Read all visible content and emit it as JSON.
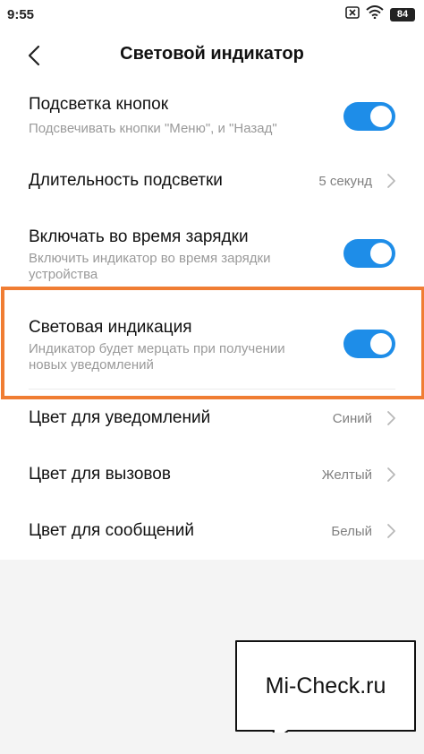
{
  "status_bar": {
    "time": "9:55",
    "battery": "84",
    "icons": [
      "notification-x-icon",
      "wifi-icon",
      "battery-icon"
    ]
  },
  "header": {
    "title": "Световой индикатор",
    "back_icon": "chevron-left-icon"
  },
  "settings": {
    "button_backlight": {
      "title": "Подсветка кнопок",
      "subtitle": "Подсвечивать кнопки \"Меню\",  и \"Назад\"",
      "enabled": true
    },
    "backlight_duration": {
      "title": "Длительность подсветки",
      "value": "5 секунд"
    },
    "charging_light": {
      "title": "Включать во время зарядки",
      "subtitle": "Включить индикатор во время зарядки устройства",
      "enabled": true
    },
    "light_indication": {
      "title": "Световая индикация",
      "subtitle": "Индикатор будет мерцать при получении новых уведомлений",
      "enabled": true
    },
    "notification_color": {
      "title": "Цвет для уведомлений",
      "value": "Синий"
    },
    "call_color": {
      "title": "Цвет для вызовов",
      "value": "Желтый"
    },
    "message_color": {
      "title": "Цвет для сообщений",
      "value": "Белый"
    }
  },
  "watermark": {
    "text": "Mi-Check.ru"
  },
  "colors": {
    "accent": "#1e8de8",
    "highlight": "#f07d33"
  }
}
